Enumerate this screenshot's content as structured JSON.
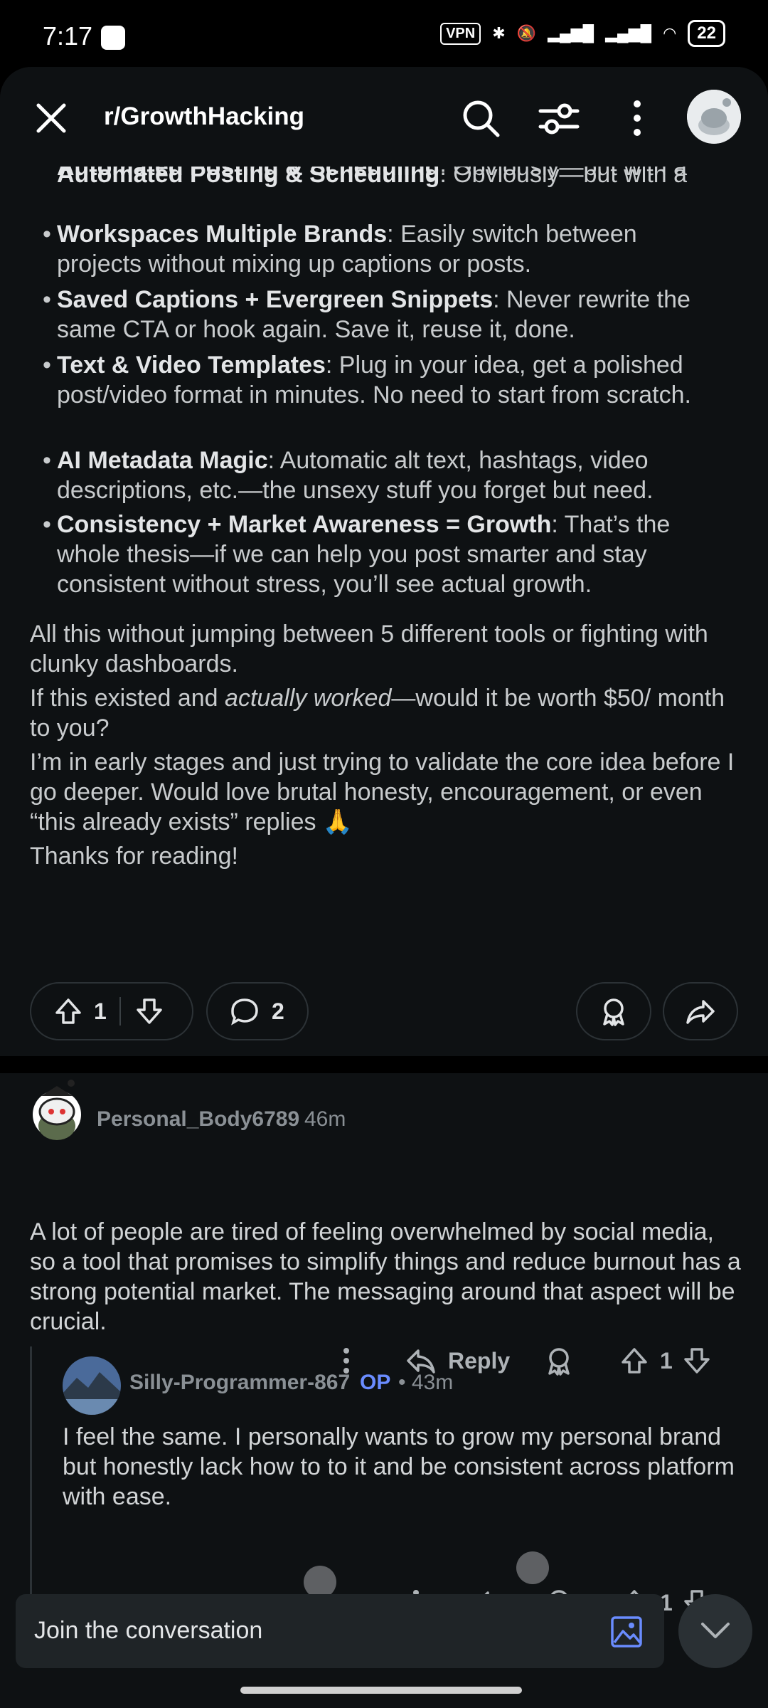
{
  "status_bar": {
    "time": "7:17",
    "vpn": "VPN",
    "battery": "22"
  },
  "header": {
    "title": "r/GrowthHacking"
  },
  "post": {
    "bullets": [
      {
        "bold": "Automated Posting & Scheduling",
        "text": ": Obviously—but with a clean UI and bulk tools that don’t feel like a chore to use."
      },
      {
        "bold": "Workspaces Multiple Brands",
        "text": ": Easily switch between projects without mixing up captions or posts."
      },
      {
        "bold": "Saved Captions + Evergreen Snippets",
        "text": ": Never rewrite the same CTA or hook again. Save it, reuse it, done."
      },
      {
        "bold": "Text & Video Templates",
        "text": ": Plug in your idea, get a polished post/video format in minutes. No need to start from scratch."
      },
      {
        "bold": "AI Metadata Magic",
        "text": ": Automatic alt text, hashtags, video descriptions, etc.—the unsexy stuff you forget but need."
      },
      {
        "bold": "Consistency + Market Awareness = Growth",
        "text": ": That’s the whole thesis—if we can help you post smarter and stay consistent without stress, you’ll see actual growth."
      }
    ],
    "para1": "All this without jumping between 5 different tools or fighting with clunky dashboards.",
    "para2_pre": "If this existed and ",
    "para2_em": "actually worked",
    "para2_post": "—would it be worth $50/ month to you?",
    "para3": "I’m in early stages and just trying to validate the core idea before I go deeper. Would love brutal honesty, encouragement, or even “this already exists” replies 🙏",
    "para4": "Thanks for reading!",
    "votes": "1",
    "comments": "2"
  },
  "comments": [
    {
      "author": "Personal_Body6789",
      "time": "46m",
      "body": "A lot of people are tired of feeling overwhelmed by social media, so a tool that promises to simplify things and reduce burnout has a strong potential market. The messaging around that aspect will be crucial.",
      "reply_label": "Reply",
      "votes": "1"
    },
    {
      "author": "Silly-Programmer-867",
      "op": "OP",
      "time": "• 43m",
      "body": "I feel the same. I personally wants to grow my personal brand but honestly lack how to to it and be consistent across platform with ease.",
      "votes": "1"
    }
  ],
  "composer": {
    "placeholder": "Join the conversation"
  }
}
